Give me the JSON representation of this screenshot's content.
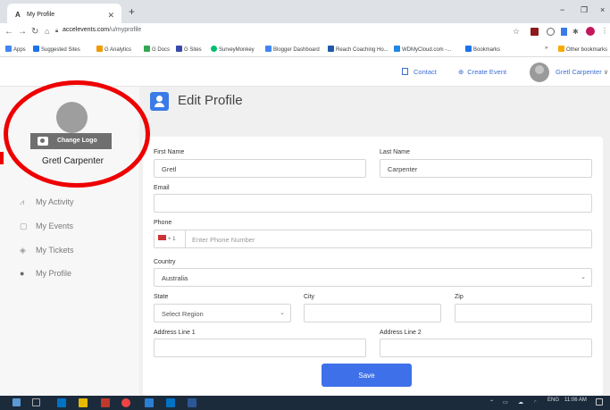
{
  "browser": {
    "tab_title": "My Profile",
    "tab_favicon": "A",
    "new_tab": "+",
    "window_controls": [
      "−",
      "❐",
      "×"
    ],
    "url_host": "accelevents.com",
    "url_path": "/u/myprofile"
  },
  "bookmarks": {
    "items": [
      "Apps",
      "Suggested Sites",
      "G Analytics",
      "G Docs",
      "G Sites",
      "SurveyMonkey",
      "Blogger Dashboard",
      "Reach Coaching Ho...",
      "WDMyCloud.com -...",
      "Bookmarks"
    ],
    "other": "Other bookmarks",
    "more": "»"
  },
  "header": {
    "contact": "Contact",
    "create_event": "Create Event",
    "user_name": "Gretl Carpenter"
  },
  "sidebar": {
    "change_logo": "Change Logo",
    "name": "Gretl Carpenter",
    "items": [
      {
        "label": "My Activity",
        "icon": "activity-icon"
      },
      {
        "label": "My Events",
        "icon": "events-icon"
      },
      {
        "label": "My Tickets",
        "icon": "ticket-icon"
      },
      {
        "label": "My Profile",
        "icon": "person-icon"
      }
    ]
  },
  "page": {
    "title": "Edit Profile"
  },
  "form": {
    "first_name_label": "First Name",
    "first_name_value": "Gretl",
    "last_name_label": "Last Name",
    "last_name_value": "Carpenter",
    "email_label": "Email",
    "email_value": "",
    "phone_label": "Phone",
    "phone_code": "+ 1",
    "phone_placeholder": "Enter Phone Number",
    "country_label": "Country",
    "country_value": "Australia",
    "state_label": "State",
    "state_value": "Select Region",
    "city_label": "City",
    "city_value": "",
    "zip_label": "Zip",
    "zip_value": "",
    "address1_label": "Address Line 1",
    "address1_value": "",
    "address2_label": "Address Line 2",
    "address2_value": "",
    "save_label": "Save"
  },
  "taskbar": {
    "language": "ENG",
    "time": "11:06 AM"
  },
  "colors": {
    "accent": "#3e71e9",
    "annotation": "#e00000"
  }
}
